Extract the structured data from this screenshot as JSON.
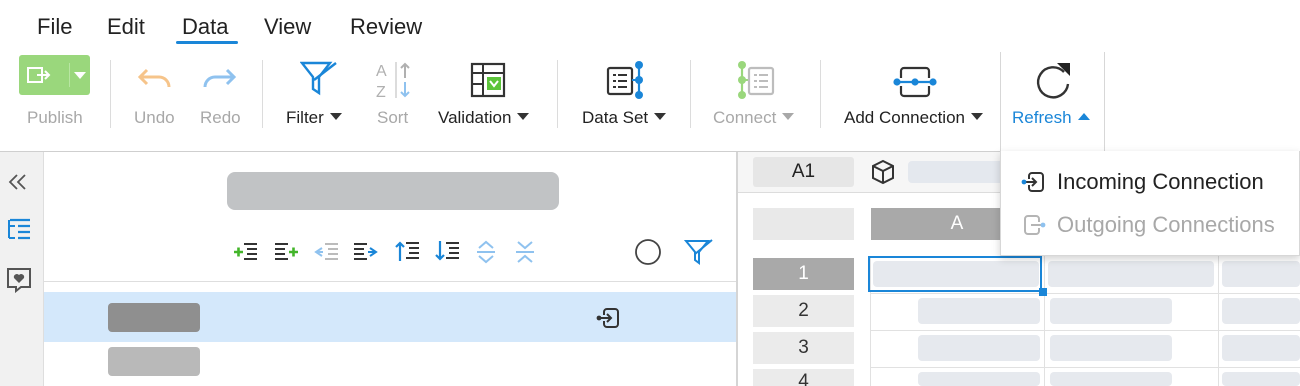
{
  "menu": {
    "items": [
      {
        "label": "File"
      },
      {
        "label": "Edit"
      },
      {
        "label": "Data",
        "active": true
      },
      {
        "label": "View"
      },
      {
        "label": "Review"
      }
    ]
  },
  "toolbar": {
    "publish": "Publish",
    "undo": "Undo",
    "redo": "Redo",
    "filter": "Filter",
    "sort": "Sort",
    "validation": "Validation",
    "data_set": "Data Set",
    "connect": "Connect",
    "add_connection": "Add Connection",
    "refresh": "Refresh"
  },
  "refresh_menu": {
    "incoming": "Incoming Connection",
    "outgoing": "Outgoing Connections"
  },
  "sheet": {
    "cell_ref": "A1",
    "column_a": "A",
    "rows": [
      "1",
      "2",
      "3",
      "4"
    ]
  },
  "colors": {
    "accent": "#1a86d8",
    "publish_green": "#9ad77c",
    "selected_row": "#d4e8fb",
    "disabled": "#a8a8a8"
  }
}
